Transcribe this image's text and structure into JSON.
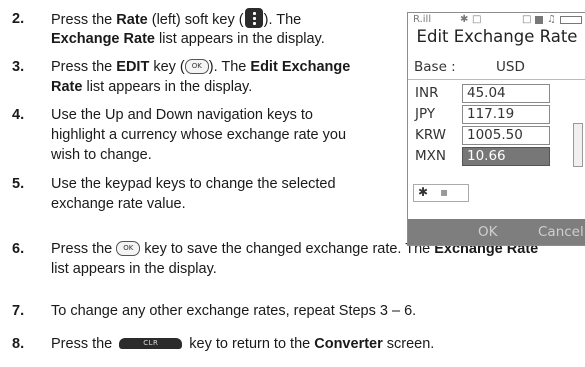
{
  "steps": [
    {
      "num": "2.",
      "lines": [
        {
          "a": "Press the ",
          "b": "Rate",
          "c": " (left) soft key (",
          "d": "). The"
        },
        {
          "b": "Exchange Rate",
          "c": " list appears in the display."
        }
      ]
    },
    {
      "num": "3.",
      "lines": [
        {
          "a": "Press the ",
          "b": "EDIT",
          "c": " key (",
          "d": "). The ",
          "e": "Edit Exchange"
        },
        {
          "b": "Rate",
          "c": " list appears in the display."
        }
      ]
    },
    {
      "num": "4.",
      "lines": [
        {
          "a": "Use the Up and Down navigation keys to"
        },
        {
          "a": "highlight a currency whose exchange rate you"
        },
        {
          "a": "wish to change."
        }
      ]
    },
    {
      "num": "5.",
      "lines": [
        {
          "a": "Use the keypad keys to change the selected"
        },
        {
          "a": "exchange rate value."
        }
      ]
    },
    {
      "num": "6.",
      "lines": [
        {
          "a": "Press the ",
          "c": " key to save the changed exchange rate. The ",
          "b": "Exchange Rate"
        },
        {
          "a": "list appears in the display."
        }
      ]
    },
    {
      "num": "7.",
      "lines": [
        {
          "a": "To change any other exchange rates, repeat Steps 3 – 6."
        }
      ]
    },
    {
      "num": "8.",
      "lines": [
        {
          "a": "Press the ",
          "c": " key to return to the ",
          "b": "Converter",
          "d": " screen."
        }
      ]
    }
  ],
  "keys": {
    "ok": "OK",
    "clr": "CLR"
  },
  "phone": {
    "status_left": "R.ill",
    "title": "Edit Exchange Rate",
    "base_label": "Base :",
    "base_value": "USD",
    "rows": [
      {
        "code": "INR",
        "value": "45.04"
      },
      {
        "code": "JPY",
        "value": "117.19"
      },
      {
        "code": "KRW",
        "value": "1005.50"
      },
      {
        "code": "MXN",
        "value": "10.66"
      }
    ],
    "icons": [
      "✱",
      "▪"
    ],
    "softkeys": {
      "center": "OK",
      "right": "Cancel"
    }
  },
  "colors": {
    "selected_row": "#777777",
    "softbar": "#7e7e7e"
  }
}
